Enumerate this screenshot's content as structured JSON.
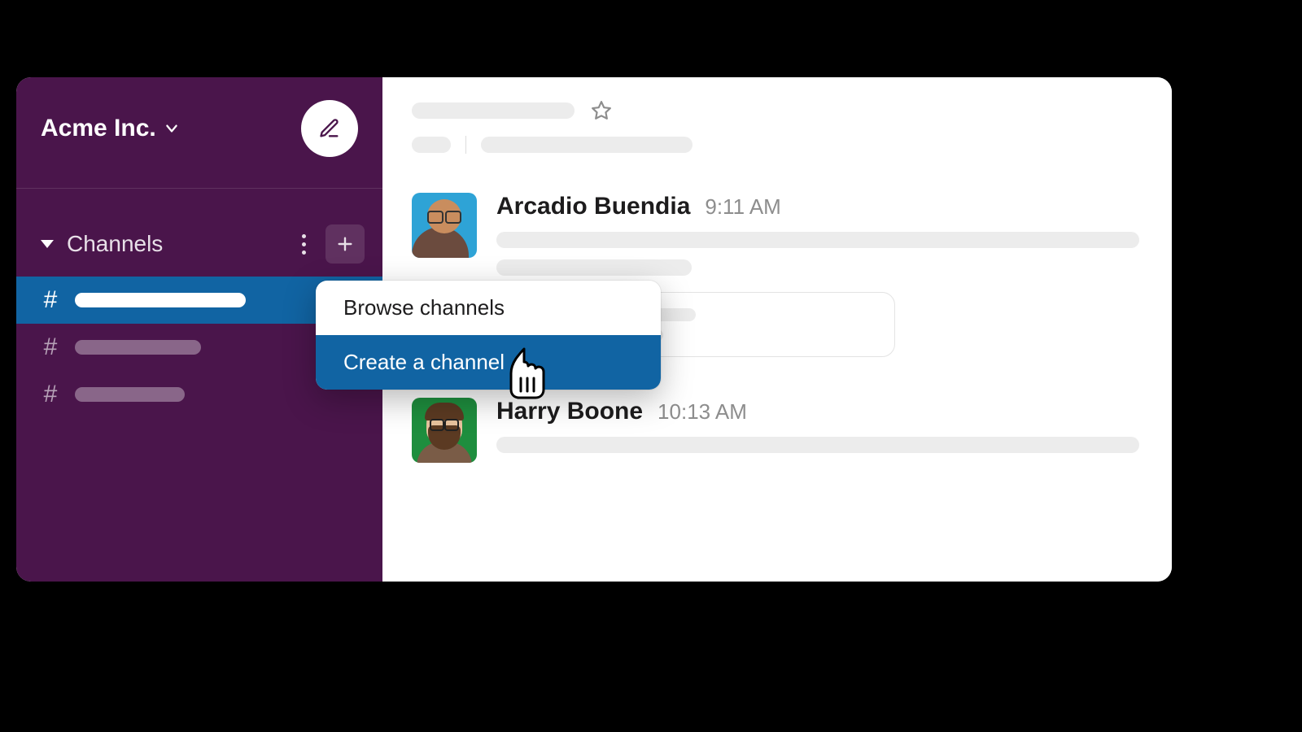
{
  "workspace": {
    "name": "Acme Inc."
  },
  "sidebar": {
    "sections": {
      "channels": {
        "title": "Channels"
      }
    }
  },
  "popup": {
    "items": [
      {
        "label": "Browse channels"
      },
      {
        "label": "Create a channel"
      }
    ]
  },
  "messages": [
    {
      "author": "Arcadio Buendia",
      "time": "9:11 AM"
    },
    {
      "author": "Harry Boone",
      "time": "10:13 AM"
    }
  ],
  "colors": {
    "sidebar": "#4A154B",
    "active": "#1164A3"
  }
}
